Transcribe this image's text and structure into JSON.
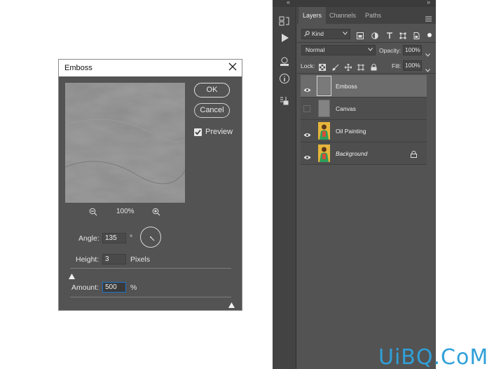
{
  "dialog": {
    "title": "Emboss",
    "ok_label": "OK",
    "cancel_label": "Cancel",
    "preview_label": "Preview",
    "preview_checked": true,
    "zoom": "100%",
    "angle_label": "Angle:",
    "angle_value": "135",
    "angle_unit": "°",
    "height_label": "Height:",
    "height_value": "3",
    "height_unit": "Pixels",
    "amount_label": "Amount:",
    "amount_value": "500",
    "amount_unit": "%"
  },
  "panel": {
    "tabs": [
      "Layers",
      "Channels",
      "Paths"
    ],
    "active_tab": "Layers",
    "filter_kind": "Kind",
    "blend_mode": "Normal",
    "opacity_label": "Opacity:",
    "opacity_value": "100%",
    "lock_label": "Lock:",
    "fill_label": "Fill:",
    "fill_value": "100%",
    "layers": [
      {
        "name": "Emboss",
        "visible": true,
        "selected": true
      },
      {
        "name": "Canvas",
        "visible": false,
        "selected": false
      },
      {
        "name": "Oil Painting",
        "visible": true,
        "selected": false
      },
      {
        "name": "Background",
        "visible": true,
        "selected": false,
        "locked": true
      }
    ]
  },
  "watermark": "UiBQ.CoM",
  "colors": {
    "dialog_bg": "#535353",
    "panel_bg": "#535353",
    "selected_layer": "#6c6c6c",
    "focus_border": "#1a73c9",
    "watermark": "#2fa0d8"
  }
}
